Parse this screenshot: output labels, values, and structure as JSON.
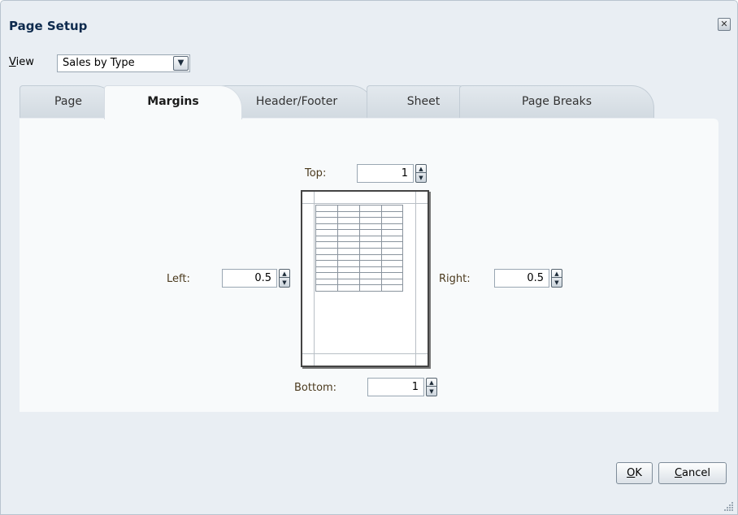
{
  "dialog": {
    "title": "Page Setup",
    "close_icon": "close-x-icon"
  },
  "view": {
    "label_mnemonic": "V",
    "label_rest": "iew",
    "selected": "Sales by Type",
    "dropdown_icon": "chevron-down-icon"
  },
  "tabs": [
    {
      "label": "Page",
      "active": false
    },
    {
      "label": "Margins",
      "active": true
    },
    {
      "label": "Header/Footer",
      "active": false
    },
    {
      "label": "Sheet",
      "active": false
    },
    {
      "label": "Page Breaks",
      "active": false
    }
  ],
  "margins": {
    "top": {
      "label": "Top:",
      "value": "1"
    },
    "left": {
      "label": "Left:",
      "value": "0.5"
    },
    "right": {
      "label": "Right:",
      "value": "0.5"
    },
    "bottom": {
      "label": "Bottom:",
      "value": "1"
    }
  },
  "buttons": {
    "ok_mnemonic": "O",
    "ok_rest": "K",
    "cancel_mnemonic": "C",
    "cancel_rest": "ancel"
  },
  "colors": {
    "dialog_bg": "#e9eef3",
    "panel_bg": "#f8fafb",
    "title": "#0d2a4d",
    "label": "#4b3a1e"
  }
}
